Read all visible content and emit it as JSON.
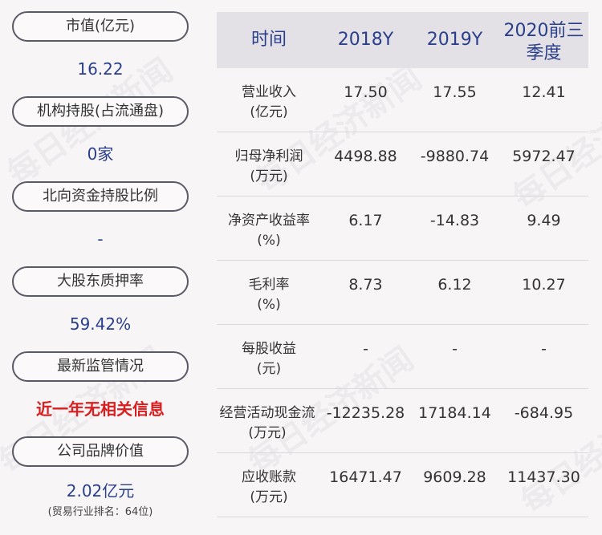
{
  "watermark": "每日经济新闻",
  "left_panel": [
    {
      "label": "市值(亿元)",
      "value": "16.22",
      "value_style": "blue"
    },
    {
      "label": "机构持股(占流通盘)",
      "value": "0家",
      "value_style": "blue"
    },
    {
      "label": "北向资金持股比例",
      "value": "-",
      "value_style": "blue"
    },
    {
      "label": "大股东质押率",
      "value": "59.42%",
      "value_style": "blue"
    },
    {
      "label": "最新监管情况",
      "value": "近一年无相关信息",
      "value_style": "red"
    },
    {
      "label": "公司品牌价值",
      "value": "2.02亿元",
      "sub": "(贸易行业排名：64位)",
      "value_style": "blue"
    }
  ],
  "table": {
    "headers": [
      "时间",
      "2018Y",
      "2019Y",
      "2020前三季度"
    ],
    "rows": [
      {
        "label1": "营业收入",
        "label2": "(亿元)",
        "v": [
          "17.50",
          "17.55",
          "12.41"
        ]
      },
      {
        "label1": "归母净利润",
        "label2": "(万元)",
        "v": [
          "4498.88",
          "-9880.74",
          "5972.47"
        ]
      },
      {
        "label1": "净资产收益率",
        "label2": "(%)",
        "v": [
          "6.17",
          "-14.83",
          "9.49"
        ]
      },
      {
        "label1": "毛利率",
        "label2": "(%)",
        "v": [
          "8.73",
          "6.12",
          "10.27"
        ]
      },
      {
        "label1": "每股收益",
        "label2": "(元)",
        "v": [
          "-",
          "-",
          "-"
        ]
      },
      {
        "label1": "经营活动现金流",
        "label2": "(万元)",
        "v": [
          "-12235.28",
          "17184.14",
          "-684.95"
        ]
      },
      {
        "label1": "应收账款",
        "label2": "(万元)",
        "v": [
          "16471.47",
          "9609.28",
          "11437.30"
        ]
      }
    ]
  },
  "colors": {
    "value_blue": "#2a3f8a",
    "alert_red": "#d81e1e",
    "header_bg": "#e3e1e6",
    "pill_border": "#5a5a66"
  }
}
